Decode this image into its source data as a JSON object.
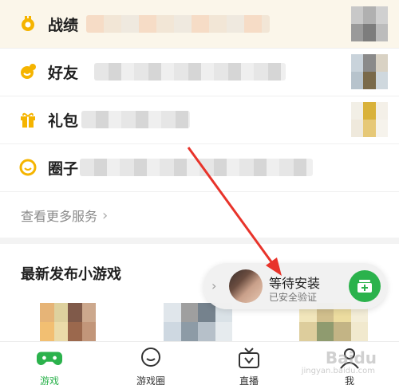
{
  "menu": {
    "items": [
      {
        "label": "战绩",
        "icon": "trophy-icon",
        "color": "#f5b400"
      },
      {
        "label": "好友",
        "icon": "friends-icon",
        "color": "#f5b400"
      },
      {
        "label": "礼包",
        "icon": "gift-icon",
        "color": "#f5b400"
      },
      {
        "label": "圈子",
        "icon": "circle-smile-icon",
        "color": "#f5b400"
      }
    ],
    "more_label": "查看更多服务"
  },
  "section": {
    "title": "最新发布小游戏"
  },
  "toast": {
    "title": "等待安装",
    "subtitle": "已安全验证",
    "action_icon": "install-icon",
    "accent": "#2bb24c"
  },
  "tabbar": {
    "tabs": [
      {
        "label": "游戏",
        "icon": "gamepad-icon",
        "active": true
      },
      {
        "label": "游戏圈",
        "icon": "chat-bubble-icon",
        "active": false
      },
      {
        "label": "直播",
        "icon": "live-tv-icon",
        "active": false
      },
      {
        "label": "我",
        "icon": "user-icon",
        "active": false
      }
    ]
  },
  "watermark": {
    "text": "Baidu",
    "sub": "jingyan.baidu.com"
  }
}
